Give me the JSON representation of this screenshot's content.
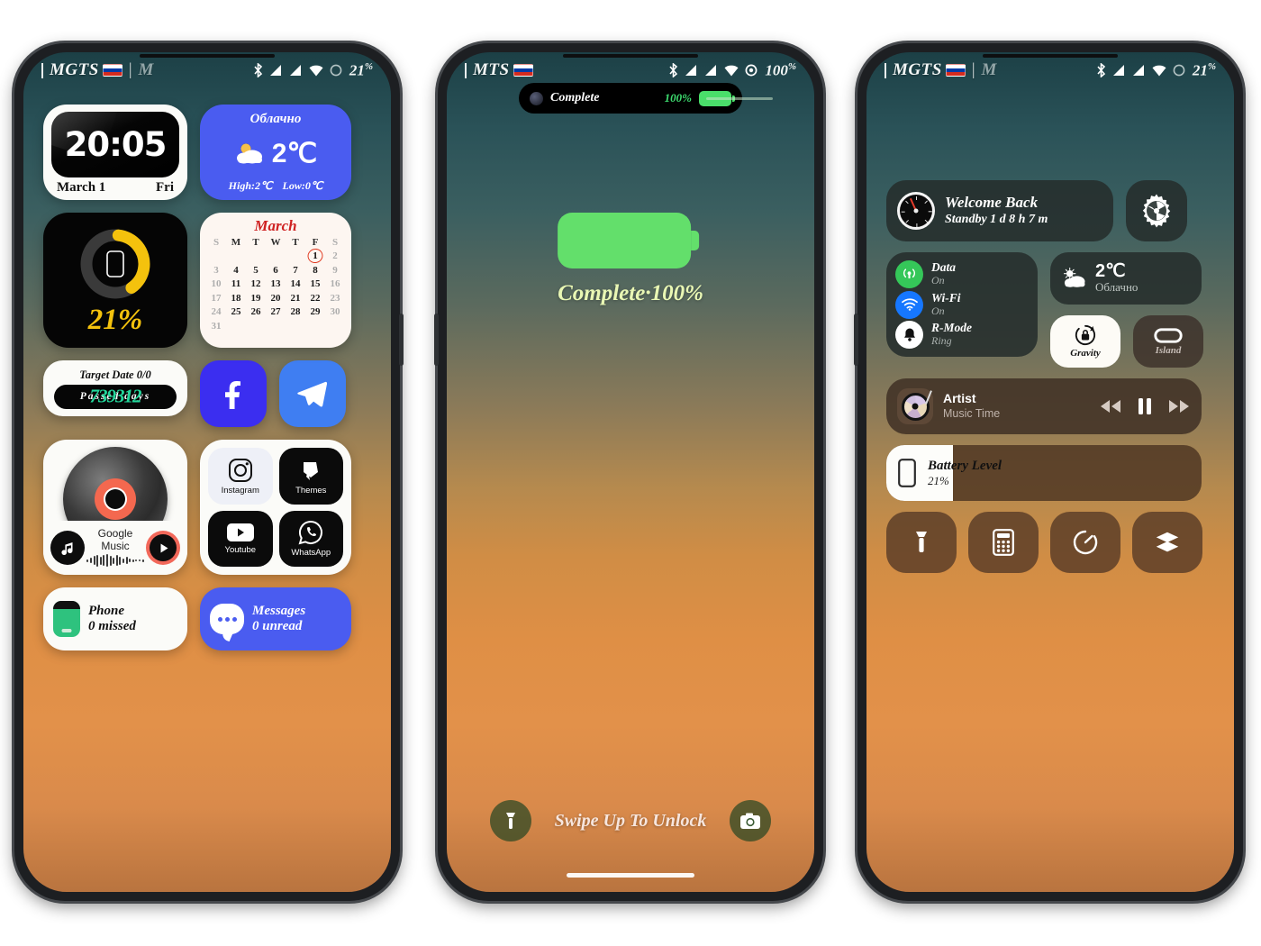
{
  "theme": {
    "accent_blue": "#4a5cf0",
    "accent_yellow": "#f4c20d",
    "accent_green": "#63df6b",
    "accent_teal": "#23d69b",
    "bg_top": "#1c4046",
    "bg_bottom": "#d98a4b"
  },
  "phone1": {
    "status": {
      "carrier": "MGTS",
      "separator": "|",
      "carrier2": "M",
      "flag": "ru-flag-icon",
      "icons": [
        "bluetooth-icon",
        "signal-icon",
        "signal-icon",
        "wifi-icon",
        "battery-circle-icon"
      ],
      "battery": "21",
      "battery_unit": "%"
    },
    "clock_widget": {
      "time": "20:05",
      "date": "March 1",
      "day": "Fri"
    },
    "weather_widget": {
      "condition": "Облачно",
      "temp": "2℃",
      "high_label": "High:2℃",
      "low_label": "Low:0℃"
    },
    "battery_widget": {
      "percent": "21%",
      "value": 21
    },
    "calendar_widget": {
      "month": "March",
      "dow": [
        "S",
        "M",
        "T",
        "W",
        "T",
        "F",
        "S"
      ],
      "weeks": [
        [
          "",
          "",
          "",
          "",
          "",
          "1",
          "2"
        ],
        [
          "3",
          "4",
          "5",
          "6",
          "7",
          "8",
          "9"
        ],
        [
          "10",
          "11",
          "12",
          "13",
          "14",
          "15",
          "16"
        ],
        [
          "17",
          "18",
          "19",
          "20",
          "21",
          "22",
          "23"
        ],
        [
          "24",
          "25",
          "26",
          "27",
          "28",
          "29",
          "30"
        ],
        [
          "31",
          "",
          "",
          "",
          "",
          "",
          ""
        ]
      ],
      "today": "1"
    },
    "target_widget": {
      "title": "Target Date 0/0",
      "label": "Passed days",
      "number": "739312"
    },
    "apps": [
      {
        "name": "facebook-app-icon",
        "label": "Facebook"
      },
      {
        "name": "telegram-app-icon",
        "label": "Telegram"
      }
    ],
    "music_widget": {
      "title": "Google Music"
    },
    "folder": [
      {
        "label": "Instagram",
        "icon": "instagram-icon",
        "style": "light"
      },
      {
        "label": "Themes",
        "icon": "themes-icon",
        "style": "dark"
      },
      {
        "label": "Youtube",
        "icon": "youtube-icon",
        "style": "dark"
      },
      {
        "label": "WhatsApp",
        "icon": "whatsapp-icon",
        "style": "dark"
      }
    ],
    "phone_widget": {
      "title": "Phone",
      "subtitle": "0 missed"
    },
    "messages_widget": {
      "title": "Messages",
      "subtitle": "0 unread"
    }
  },
  "phone2": {
    "status": {
      "carrier": "MTS",
      "flag": "ru-flag-icon",
      "battery": "100",
      "battery_unit": "%"
    },
    "island": {
      "label": "Complete",
      "percent": "100%"
    },
    "charging": {
      "caption": "Complete·100%"
    },
    "unlock_text": "Swipe Up To Unlock",
    "left_button": "flashlight-icon",
    "right_button": "camera-icon"
  },
  "phone3": {
    "status": {
      "carrier": "MGTS",
      "separator": "|",
      "carrier2": "M",
      "battery": "21",
      "battery_unit": "%"
    },
    "welcome": {
      "title": "Welcome Back",
      "subtitle": "Standby 1 d 8 h 7 m"
    },
    "gear_button": "settings-gear-icon",
    "toggles": [
      {
        "name": "Data",
        "value": "On",
        "icon": "cellular-data-icon",
        "color": "#35c759"
      },
      {
        "name": "Wi-Fi",
        "value": "On",
        "icon": "wifi-icon",
        "color": "#1677ff"
      },
      {
        "name": "R-Mode",
        "value": "Ring",
        "icon": "bell-icon",
        "color": "#ffffff"
      }
    ],
    "weather": {
      "temp": "2℃",
      "condition": "Облачно"
    },
    "gravity_button": {
      "label": "Gravity",
      "icon": "rotation-lock-icon",
      "state": "on"
    },
    "island_button": {
      "label": "Island",
      "icon": "dynamic-island-icon",
      "state": "off"
    },
    "player": {
      "artist": "Artist",
      "track": "Music Time"
    },
    "battery_level": {
      "title": "Battery Level",
      "value": "21%",
      "percent": 21
    },
    "shortcuts": [
      {
        "name": "flashlight-shortcut",
        "icon": "flashlight-icon"
      },
      {
        "name": "calculator-shortcut",
        "icon": "calculator-icon"
      },
      {
        "name": "timer-shortcut",
        "icon": "timer-icon"
      },
      {
        "name": "screen-record-shortcut",
        "icon": "layers-icon"
      }
    ]
  }
}
